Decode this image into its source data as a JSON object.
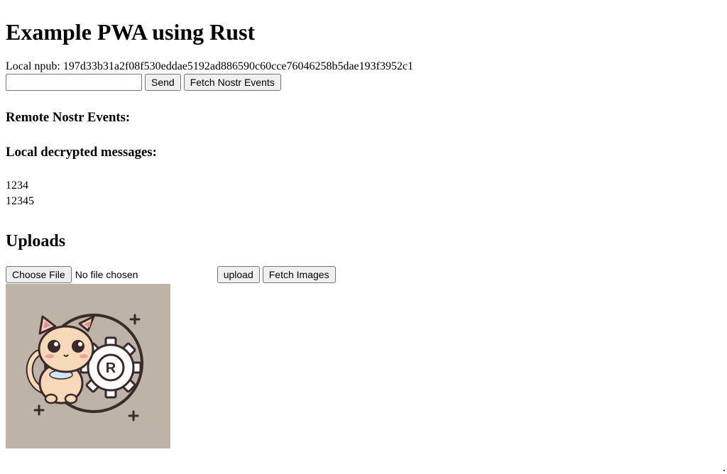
{
  "header": {
    "title": "Example PWA using Rust"
  },
  "npub": {
    "text": "Local npub: 197d33b31a2f08f530eddae5192ad886590c60cce76046258b5dae193f3952c1"
  },
  "message_form": {
    "input_value": "",
    "send_label": "Send",
    "fetch_label": "Fetch Nostr Events"
  },
  "remote_events": {
    "heading": "Remote Nostr Events:"
  },
  "local_messages": {
    "heading": "Local decrypted messages:",
    "items": [
      "1234",
      "12345"
    ]
  },
  "uploads": {
    "heading": "Uploads",
    "choose_file_label": "Choose File",
    "no_file_text": "No file chosen",
    "upload_label": "upload",
    "fetch_images_label": "Fetch Images"
  },
  "image": {
    "icon": "cat-gear-sticker-icon",
    "colors": {
      "background": "#bdb3a7",
      "cat": "#f6d9b8",
      "gear": "#ffffff",
      "outline": "#3a2a2a",
      "accent": "#e98aa0"
    }
  }
}
